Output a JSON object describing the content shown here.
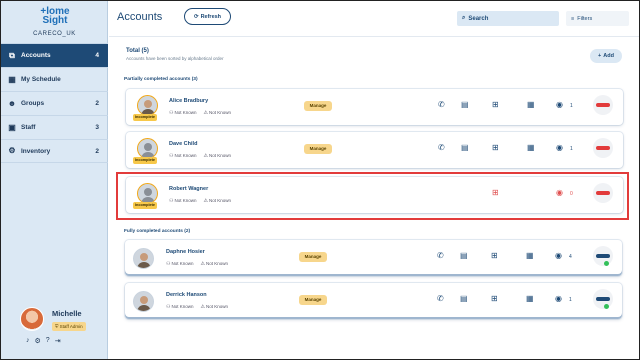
{
  "sidebar": {
    "logo_line1": "+lome",
    "logo_line2": "Sight",
    "org": "CARECO_UK",
    "items": [
      {
        "label": "Accounts",
        "count": "4",
        "icon": "accounts-icon",
        "glyph": "⧉"
      },
      {
        "label": "My Schedule",
        "count": "",
        "icon": "calendar-icon",
        "glyph": "▦"
      },
      {
        "label": "Groups",
        "count": "2",
        "icon": "groups-icon",
        "glyph": "☻"
      },
      {
        "label": "Staff",
        "count": "3",
        "icon": "staff-icon",
        "glyph": "▣"
      },
      {
        "label": "Inventory",
        "count": "2",
        "icon": "inventory-icon",
        "glyph": "⚙"
      }
    ],
    "profile": {
      "name": "Michelle",
      "role": "Staff Admin"
    }
  },
  "header": {
    "title": "Accounts",
    "refresh_label": "Refresh",
    "search_label": "Search",
    "filters_label": "Filters"
  },
  "summary": {
    "total": "Total (5)",
    "sorted_note": "Accounts have been sorted by alphabetical order",
    "add_label": "Add"
  },
  "sections": {
    "partial": "Partially completed accounts (3)",
    "complete": "Fully completed accounts (2)"
  },
  "accounts": [
    {
      "name": "Alice Bradbury",
      "meta1": "Not Known",
      "meta2": "Not Known",
      "tag": "Incomplete",
      "manage": "Manage",
      "count": "1"
    },
    {
      "name": "Dave Child",
      "meta1": "Not Known",
      "meta2": "Not Known",
      "tag": "Incomplete",
      "manage": "Manage",
      "count": "1"
    },
    {
      "name": "Robert Wagner",
      "meta1": "Not Known",
      "meta2": "Not Known",
      "tag": "Incomplete",
      "count": "0"
    },
    {
      "name": "Daphne Hosier",
      "meta1": "Not Known",
      "meta2": "Not Known",
      "manage": "Manage",
      "count": "4"
    },
    {
      "name": "Derrick Hanson",
      "meta1": "Not Known",
      "meta2": "Not Known",
      "manage": "Manage",
      "count": "1"
    }
  ],
  "colors": {
    "accent": "#1e4a76",
    "warning": "#f7d68c",
    "alert": "#e23b3b",
    "online": "#33c05a"
  }
}
